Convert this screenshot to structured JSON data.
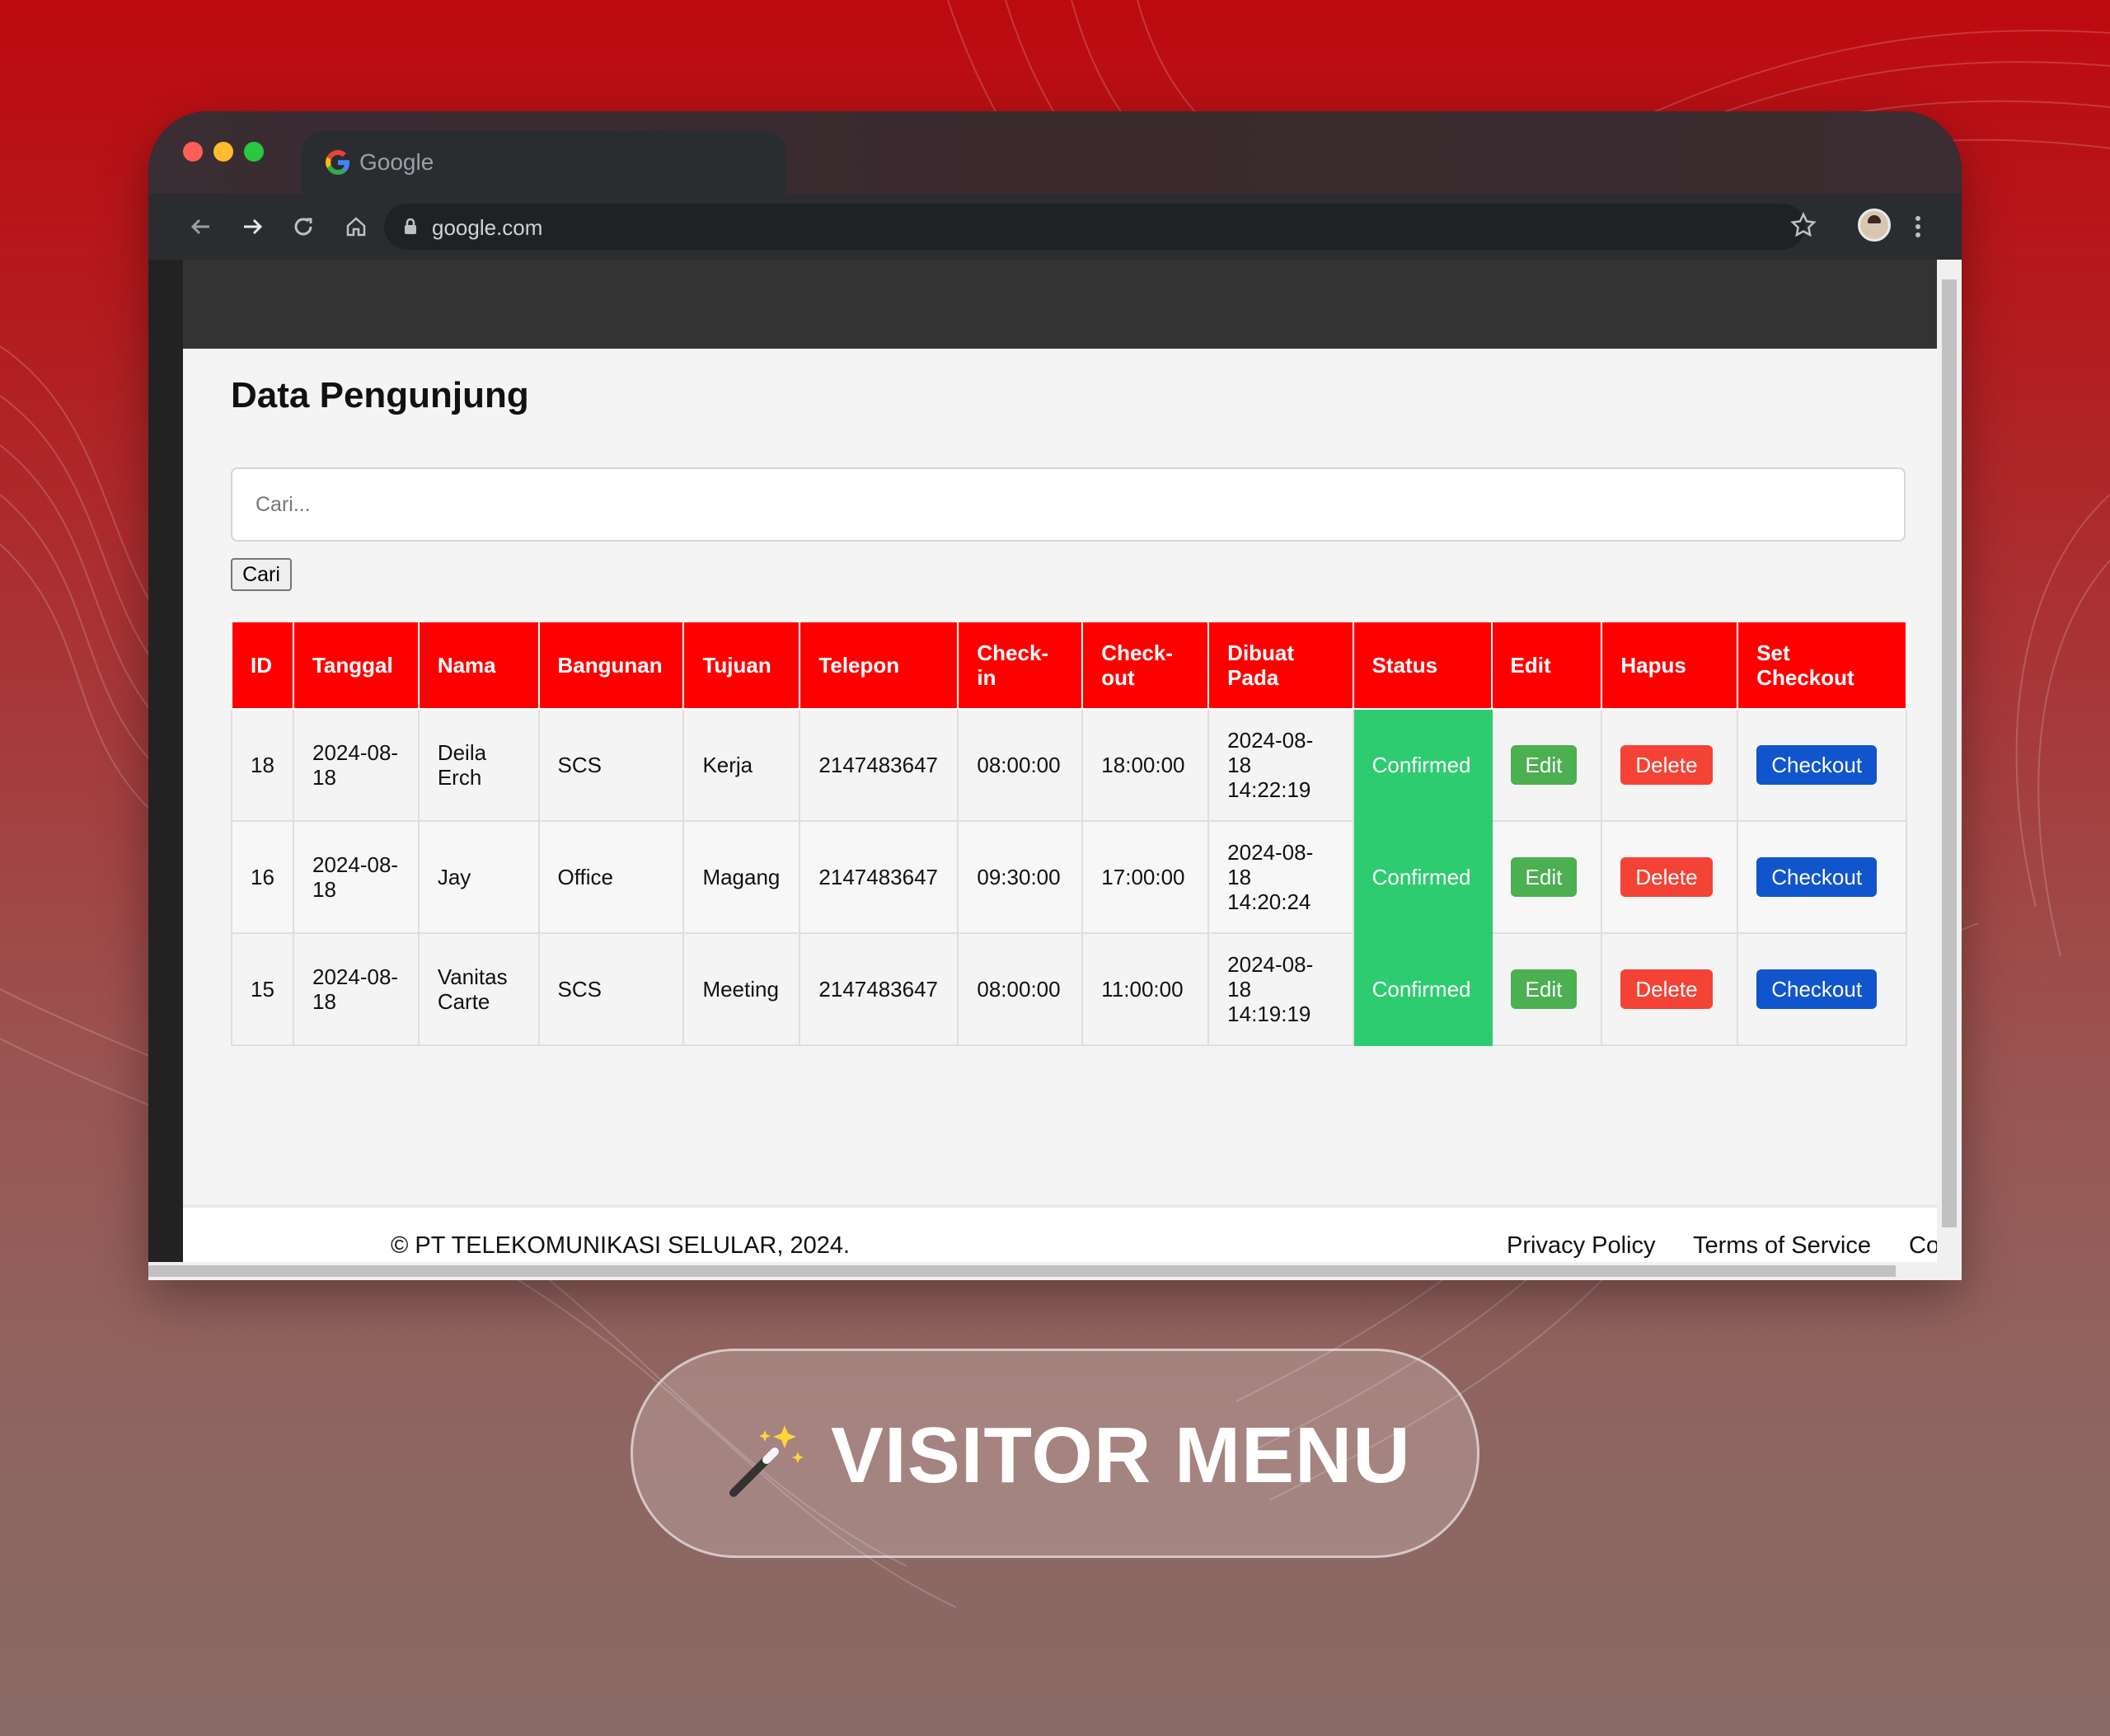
{
  "browser": {
    "tab_title": "Google",
    "url": "google.com"
  },
  "page": {
    "title": "Data Pengunjung",
    "search": {
      "placeholder": "Cari...",
      "button_label": "Cari"
    },
    "table": {
      "headers": [
        "ID",
        "Tanggal",
        "Nama",
        "Bangunan",
        "Tujuan",
        "Telepon",
        "Check-in",
        "Check-out",
        "Dibuat Pada",
        "Status",
        "Edit",
        "Hapus",
        "Set Checkout"
      ],
      "rows": [
        {
          "id": "18",
          "tanggal": "2024-08-18",
          "nama": "Deila Erch",
          "bangunan": "SCS",
          "tujuan": "Kerja",
          "telepon": "2147483647",
          "checkin": "08:00:00",
          "checkout": "18:00:00",
          "dibuat": "2024-08-18 14:22:19",
          "status": "Confirmed",
          "edit": "Edit",
          "hapus": "Delete",
          "set_checkout": "Checkout"
        },
        {
          "id": "16",
          "tanggal": "2024-08-18",
          "nama": "Jay",
          "bangunan": "Office",
          "tujuan": "Magang",
          "telepon": "2147483647",
          "checkin": "09:30:00",
          "checkout": "17:00:00",
          "dibuat": "2024-08-18 14:20:24",
          "status": "Confirmed",
          "edit": "Edit",
          "hapus": "Delete",
          "set_checkout": "Checkout"
        },
        {
          "id": "15",
          "tanggal": "2024-08-18",
          "nama": "Vanitas Carte",
          "bangunan": "SCS",
          "tujuan": "Meeting",
          "telepon": "2147483647",
          "checkin": "08:00:00",
          "checkout": "11:00:00",
          "dibuat": "2024-08-18 14:19:19",
          "status": "Confirmed",
          "edit": "Edit",
          "hapus": "Delete",
          "set_checkout": "Checkout"
        }
      ]
    },
    "footer": {
      "copyright": "© PT TELEKOMUNIKASI SELULAR, 2024.",
      "links": [
        "Privacy Policy",
        "Terms of Service",
        "Contact Us"
      ]
    }
  },
  "badge": {
    "label": "VISITOR MENU",
    "icon": "magic-wand-icon"
  },
  "colors": {
    "table_header": "#ff0000",
    "status_confirmed": "#2ecc71",
    "edit_button": "#4caf50",
    "delete_button": "#f44336",
    "checkout_button": "#1155cc"
  }
}
